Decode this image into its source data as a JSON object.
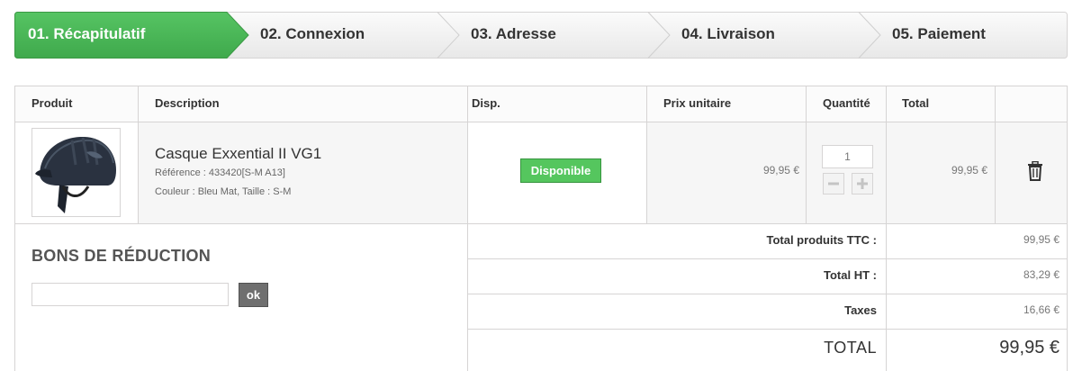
{
  "steps": [
    {
      "label": "01. Récapitulatif",
      "active": true
    },
    {
      "label": "02. Connexion",
      "active": false
    },
    {
      "label": "03. Adresse",
      "active": false
    },
    {
      "label": "04. Livraison",
      "active": false
    },
    {
      "label": "05. Paiement",
      "active": false
    }
  ],
  "table": {
    "headers": {
      "product": "Produit",
      "description": "Description",
      "availability": "Disp.",
      "unit_price": "Prix unitaire",
      "quantity": "Quantité",
      "total": "Total"
    }
  },
  "item": {
    "name": "Casque Exxential II VG1",
    "reference": "Référence : 433420[S-M A13]",
    "attributes": "Couleur : Bleu Mat, Taille : S-M",
    "availability": "Disponible",
    "unit_price": "99,95 €",
    "quantity": "1",
    "total": "99,95 €",
    "image": "riding-helmet-photo"
  },
  "voucher": {
    "title": "BONS DE RÉDUCTION",
    "input_value": "",
    "button_label": "ok"
  },
  "summary": {
    "products_label": "Total produits TTC :",
    "products_value": "99,95 €",
    "ht_label": "Total HT :",
    "ht_value": "83,29 €",
    "taxes_label": "Taxes",
    "taxes_value": "16,66 €",
    "total_label": "TOTAL",
    "total_value": "99,95 €"
  },
  "colors": {
    "active_step": "#4cb85a",
    "available_badge": "#55c65e",
    "voucher_button": "#6f6f6f"
  }
}
